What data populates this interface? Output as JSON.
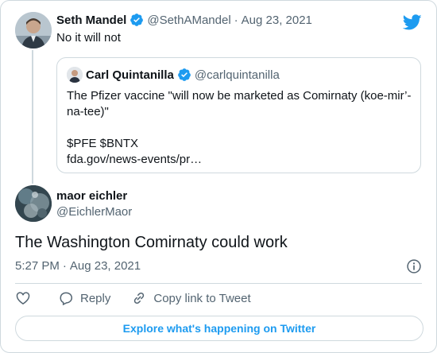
{
  "reply": {
    "author_name": "Seth Mandel",
    "author_handle": "@SethAMandel",
    "separator": "·",
    "date": "Aug 23, 2021",
    "text": "No it will not"
  },
  "quote": {
    "author_name": "Carl Quintanilla",
    "author_handle": "@carlquintanilla",
    "line1": "The Pfizer vaccine \"will now be marketed as Comirnaty (koe-mir’-na-tee)\"",
    "line2": "$PFE $BNTX",
    "line3": "fda.gov/news-events/pr…"
  },
  "tweet": {
    "author_name": "maor eichler",
    "author_handle": "@EichlerMaor",
    "text": "The Washington Comirnaty could work",
    "time": "5:27 PM",
    "separator": "·",
    "date": "Aug 23, 2021"
  },
  "actions": {
    "reply_label": "Reply",
    "copy_label": "Copy link to Tweet"
  },
  "explore_label": "Explore what's happening on Twitter",
  "colors": {
    "twitter_blue": "#1d9bf0",
    "muted_text": "#536471",
    "border": "#cfd9de",
    "text": "#0f1419"
  },
  "icons": [
    "twitter-bird-icon",
    "verified-badge-icon",
    "info-icon",
    "heart-icon",
    "reply-bubble-icon",
    "link-icon"
  ]
}
